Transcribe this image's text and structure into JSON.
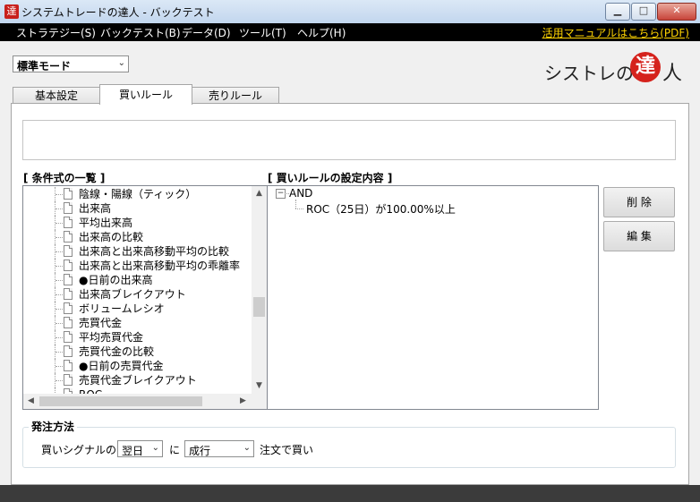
{
  "window": {
    "title": "システムトレードの達人 - バックテスト",
    "minimize": "▁",
    "maximize": "□",
    "close": "✕",
    "app_icon": "達"
  },
  "menu": {
    "items": [
      "ストラテジー(S)",
      "バックテスト(B)",
      "データ(D)",
      "ツール(T)",
      "ヘルプ(H)"
    ],
    "manual_link": "活用マニュアルはこちら(PDF)"
  },
  "mode_select": {
    "value": "標準モード"
  },
  "logo": {
    "text": "シストレの",
    "circle": "達",
    "tail": "人"
  },
  "tabs": [
    {
      "label": "基本設定",
      "active": false
    },
    {
      "label": "買いルール",
      "active": true
    },
    {
      "label": "売りルール",
      "active": false
    }
  ],
  "conditions": {
    "header": "[ 条件式の一覧 ]",
    "items": [
      "陰線・陽線（ティック）",
      "出来高",
      "平均出来高",
      "出来高の比較",
      "出来高と出来高移動平均の比較",
      "出来高と出来高移動平均の乖離率",
      "●日前の出来高",
      "出来高ブレイクアウト",
      "ボリュームレシオ",
      "売買代金",
      "平均売買代金",
      "売買代金の比較",
      "●日前の売買代金",
      "売買代金ブレイクアウト",
      "ROC"
    ]
  },
  "buy_rule": {
    "header": "[ 買いルールの設定内容 ]",
    "root": "AND",
    "child": "ROC（25日）が100.00%以上",
    "expander": "−"
  },
  "buttons": {
    "delete": "削 除",
    "edit": "編 集"
  },
  "order": {
    "title": "発注方法",
    "prefix": "買いシグナルの",
    "timing": "翌日",
    "particle": "に",
    "type": "成行",
    "suffix": "注文で買い"
  },
  "colors": {
    "menubar": "#000000",
    "manual_link": "#ffd400",
    "logo_red": "#d5221c"
  }
}
